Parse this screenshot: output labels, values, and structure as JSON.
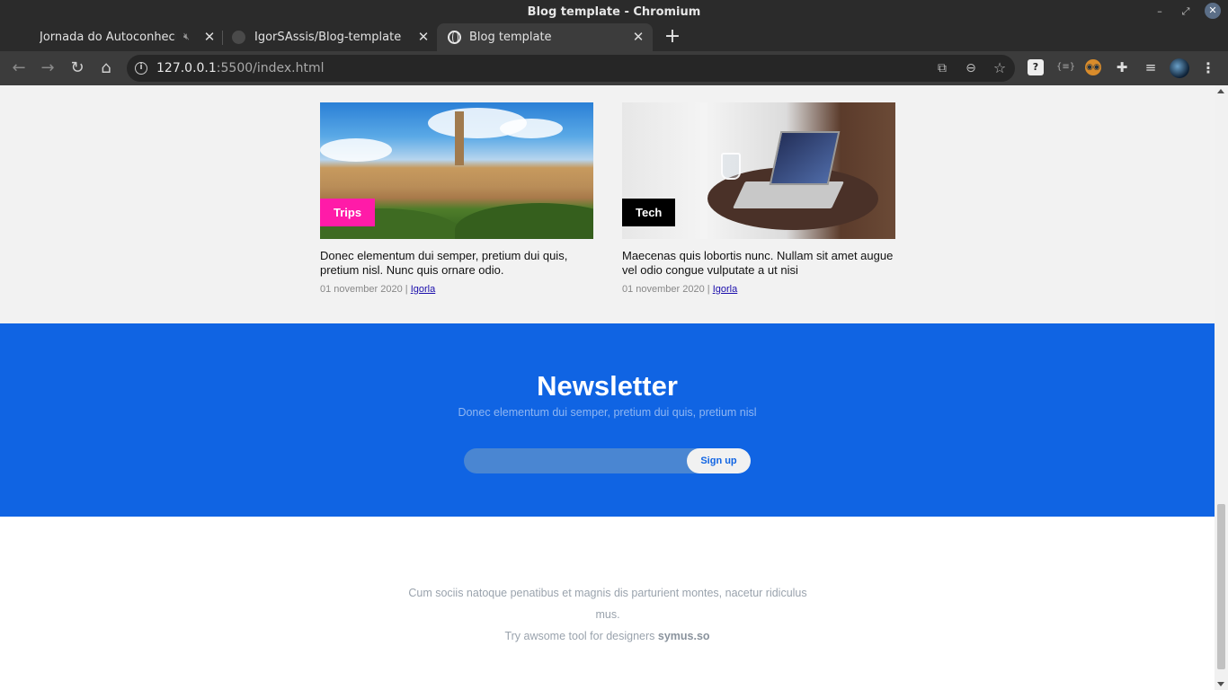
{
  "window": {
    "title": "Blog template - Chromium",
    "controls": {
      "minimize": "–",
      "maximize": "⤢",
      "close": "✕"
    }
  },
  "tabs": [
    {
      "title": "Jornada do Autoconhecim",
      "muted": true,
      "active": false
    },
    {
      "title": "IgorSAssis/Blog-template",
      "active": false
    },
    {
      "title": "Blog template",
      "active": true
    }
  ],
  "toolbar": {
    "url_host": "127.0.0.1",
    "url_path": ":5500/index.html",
    "icons": [
      "back-icon",
      "forward-icon",
      "reload-icon",
      "home-icon",
      "info-icon",
      "translate-icon",
      "zoom-icon",
      "star-icon",
      "extensions-icon",
      "media-icon",
      "profile-avatar",
      "menu-icon"
    ]
  },
  "posts": [
    {
      "category": "Trips",
      "category_color": "#ff1ba8",
      "title": "Donec elementum dui semper, pretium dui quis, pretium nisl. Nunc quis ornare odio.",
      "date": "01 november 2020",
      "separator": "|",
      "author": "Igorla"
    },
    {
      "category": "Tech",
      "category_color": "#000000",
      "title": "Maecenas quis lobortis nunc. Nullam sit amet augue vel odio congue vulputate a ut nisi",
      "date": "01 november 2020",
      "separator": "|",
      "author": "Igorla"
    }
  ],
  "newsletter": {
    "title": "Newsletter",
    "subtitle": "Donec elementum dui semper, pretium dui quis, pretium nisl",
    "input_placeholder": "",
    "button_label": "Sign up",
    "background": "#1064e3"
  },
  "footer": {
    "text": "Cum sociis natoque penatibus et magnis dis parturient montes, nacetur ridiculus mus.",
    "cta_prefix": "Try awsome tool for designers",
    "cta_brand": "symus.so"
  }
}
